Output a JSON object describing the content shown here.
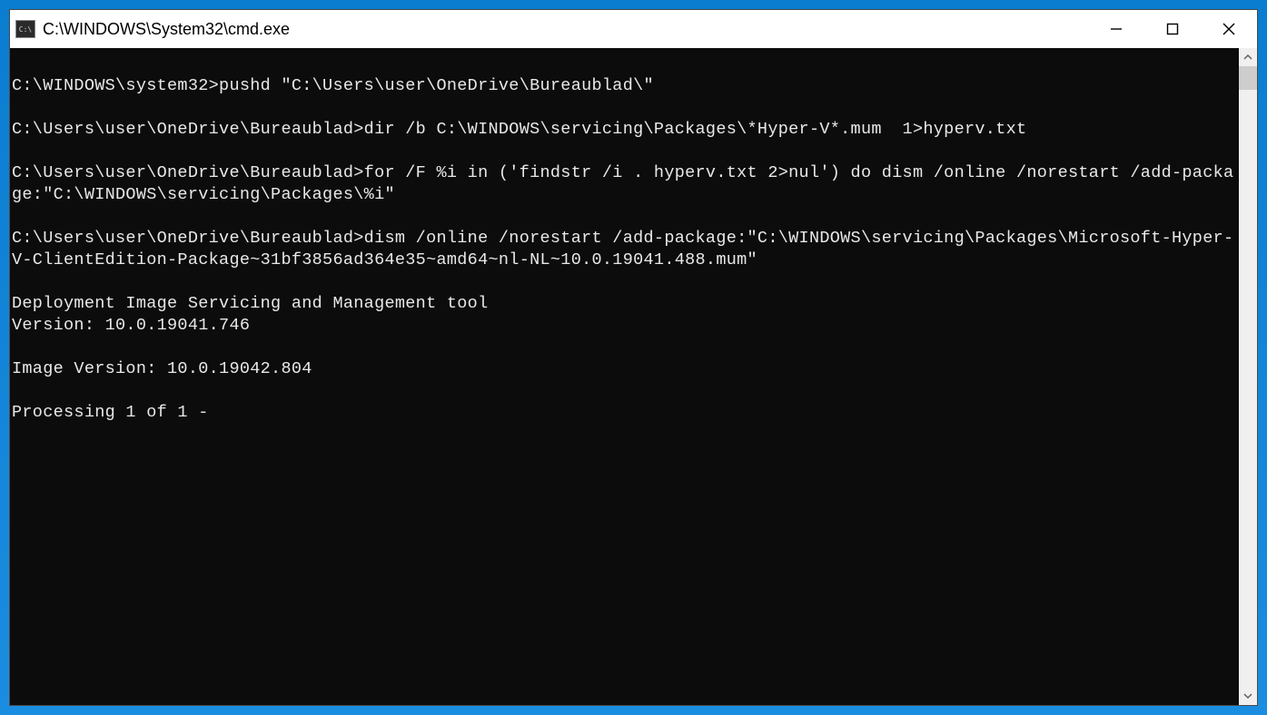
{
  "window": {
    "title": "C:\\WINDOWS\\System32\\cmd.exe"
  },
  "terminal": {
    "lines": [
      "",
      "C:\\WINDOWS\\system32>pushd \"C:\\Users\\user\\OneDrive\\Bureaublad\\\"",
      "",
      "C:\\Users\\user\\OneDrive\\Bureaublad>dir /b C:\\WINDOWS\\servicing\\Packages\\*Hyper-V*.mum  1>hyperv.txt",
      "",
      "C:\\Users\\user\\OneDrive\\Bureaublad>for /F %i in ('findstr /i . hyperv.txt 2>nul') do dism /online /norestart /add-package:\"C:\\WINDOWS\\servicing\\Packages\\%i\"",
      "",
      "C:\\Users\\user\\OneDrive\\Bureaublad>dism /online /norestart /add-package:\"C:\\WINDOWS\\servicing\\Packages\\Microsoft-Hyper-V-ClientEdition-Package~31bf3856ad364e35~amd64~nl-NL~10.0.19041.488.mum\"",
      "",
      "Deployment Image Servicing and Management tool",
      "Version: 10.0.19041.746",
      "",
      "Image Version: 10.0.19042.804",
      "",
      "Processing 1 of 1 -"
    ]
  }
}
